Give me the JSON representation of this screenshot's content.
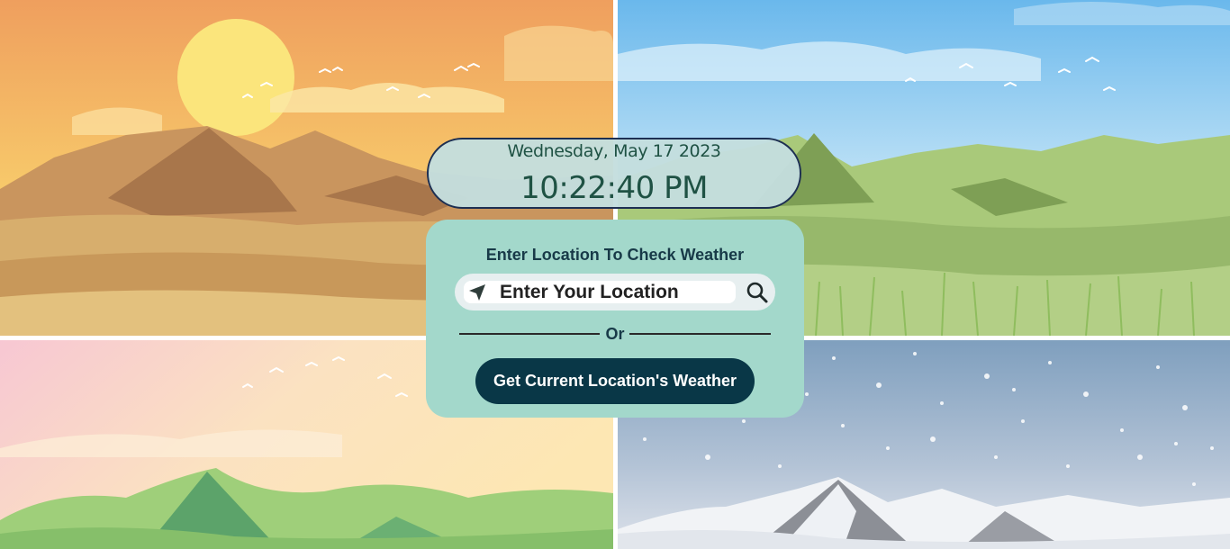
{
  "clock": {
    "date": "Wednesday, May 17 2023",
    "time": "10:22:40 PM"
  },
  "weather_card": {
    "heading": "Enter Location To Check Weather",
    "search": {
      "placeholder": "Enter Your Location",
      "value": "",
      "leading_icon": "location-arrow-icon",
      "trailing_icon": "search-icon"
    },
    "separator": "Or",
    "current_location_button": "Get Current Location's Weather"
  },
  "background": {
    "scenes": [
      "summer",
      "spring",
      "autumn",
      "winter"
    ]
  },
  "colors": {
    "card_bg": "#a3d8cb",
    "clock_bg": "#c4dede",
    "clock_border": "#1d2f52",
    "clock_text": "#1f5244",
    "heading_text": "#183a48",
    "button_bg": "#093747",
    "button_text": "#ffffff"
  }
}
